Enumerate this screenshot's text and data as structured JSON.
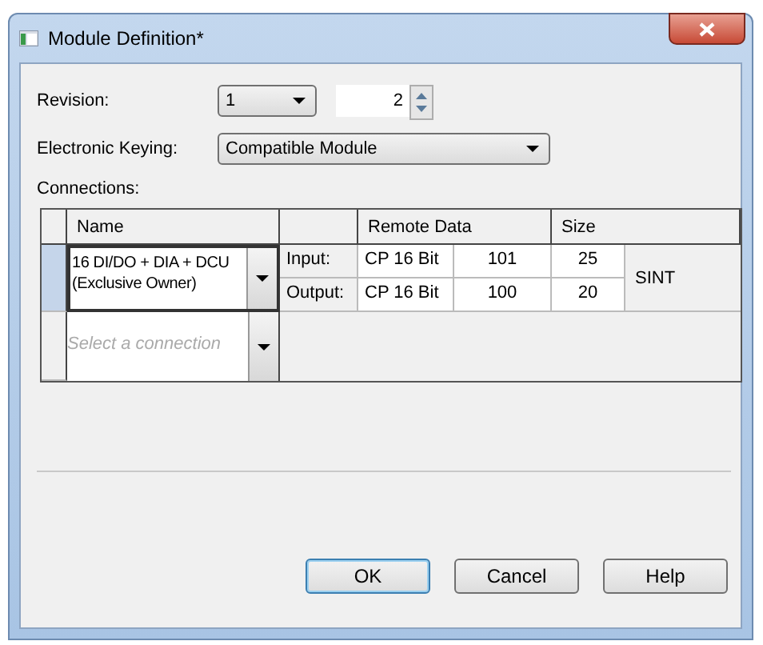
{
  "window": {
    "title": "Module Definition*"
  },
  "revision": {
    "label": "Revision:",
    "major": "1",
    "minor": "2"
  },
  "electronic_keying": {
    "label": "Electronic Keying:",
    "value": "Compatible Module"
  },
  "connections": {
    "label": "Connections:",
    "headers": {
      "name": "Name",
      "remote_data": "Remote Data",
      "size": "Size"
    },
    "rows": [
      {
        "name": "16 DI/DO + DIA + DCU\n(Exclusive Owner)",
        "selected": true,
        "input": {
          "label": "Input:",
          "data": "CP 16 Bit",
          "instance": "101",
          "size": "25"
        },
        "output": {
          "label": "Output:",
          "data": "CP 16 Bit",
          "instance": "100",
          "size": "20"
        },
        "type": "SINT"
      }
    ],
    "new_row": {
      "placeholder": "Select a connection"
    }
  },
  "buttons": [
    {
      "label": "OK",
      "default": true
    },
    {
      "label": "Cancel",
      "default": false
    },
    {
      "label": "Help",
      "default": false
    }
  ]
}
